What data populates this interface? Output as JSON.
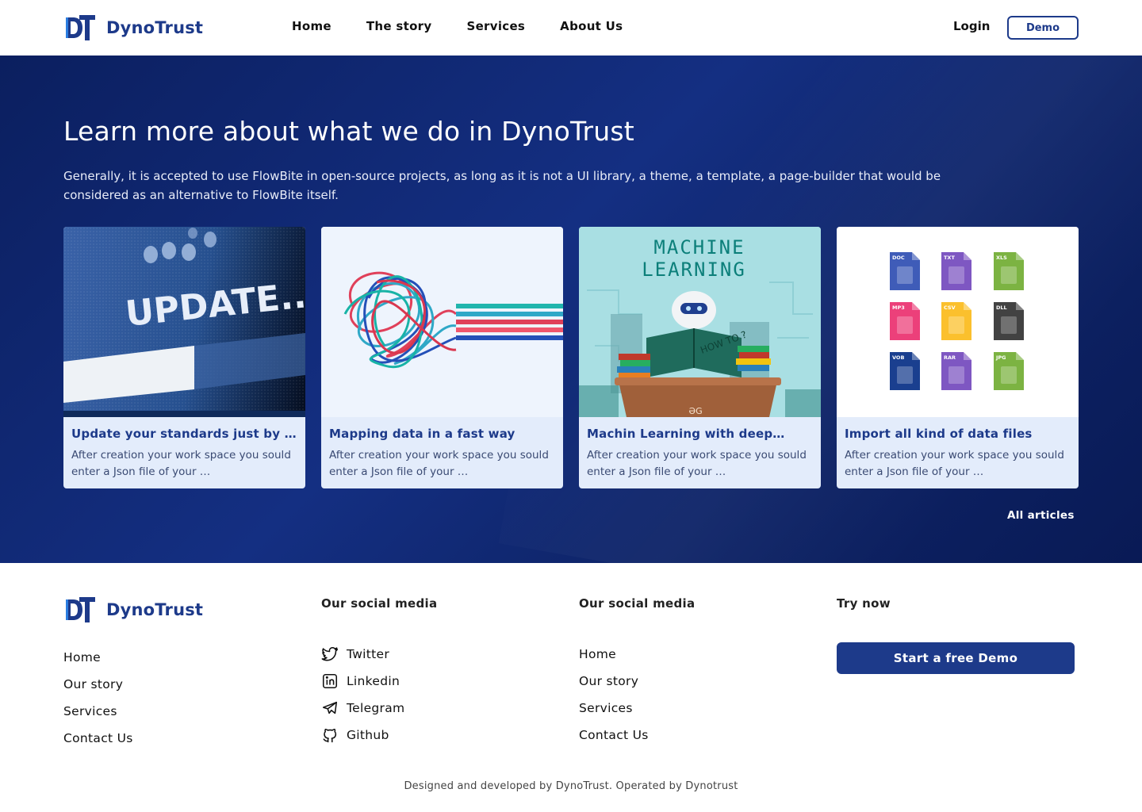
{
  "brand": {
    "name": "DynoTrust",
    "mark": "DT",
    "color": "#1d3a8a"
  },
  "nav": {
    "links": [
      "Home",
      "The story",
      "Services",
      "About Us"
    ],
    "login": "Login",
    "demo": "Demo"
  },
  "hero": {
    "title": "Learn more about what we do in DynoTrust",
    "description": "Generally, it is accepted to use FlowBite in open-source projects, as long as it is not a UI library, a theme, a template, a page-builder that would be considered as an alternative to FlowBite itself.",
    "cards": [
      {
        "title": "Update your standards just by o…",
        "text": "After creation your work space you sould enter a Json file of your …",
        "image_text": "UPDATE..."
      },
      {
        "title": "Mapping data in a fast way",
        "text": "After creation your work space you sould enter a Json file of your …"
      },
      {
        "title": "Machin Learning with deep…",
        "text": "After creation your work space you sould enter a Json file of your …",
        "image_text_1": "MACHINE",
        "image_text_2": "LEARNING",
        "book_text": "HOW TO ?",
        "badge": "ƏG"
      },
      {
        "title": "Import all kind of data files",
        "text": "After creation your work space you sould enter a Json file of your …",
        "file_types": [
          "DOC",
          "TXT",
          "XLS",
          "MP3",
          "CSV",
          "DLL",
          "VOB",
          "RAR",
          "JPG"
        ]
      }
    ],
    "all_articles": "All articles"
  },
  "footer": {
    "col1": [
      "Home",
      "Our story",
      "Services",
      "Contact Us"
    ],
    "col2": {
      "heading": "Our social media",
      "items": [
        "Twitter",
        "Linkedin",
        "Telegram",
        "Github"
      ]
    },
    "col3": {
      "heading": "Our social media",
      "items": [
        "Home",
        "Our story",
        "Services",
        "Contact Us"
      ]
    },
    "col4": {
      "heading": "Try now",
      "button": "Start a free Demo"
    },
    "credits": "Designed and developed by DynoTrust. Operated by Dynotrust"
  }
}
